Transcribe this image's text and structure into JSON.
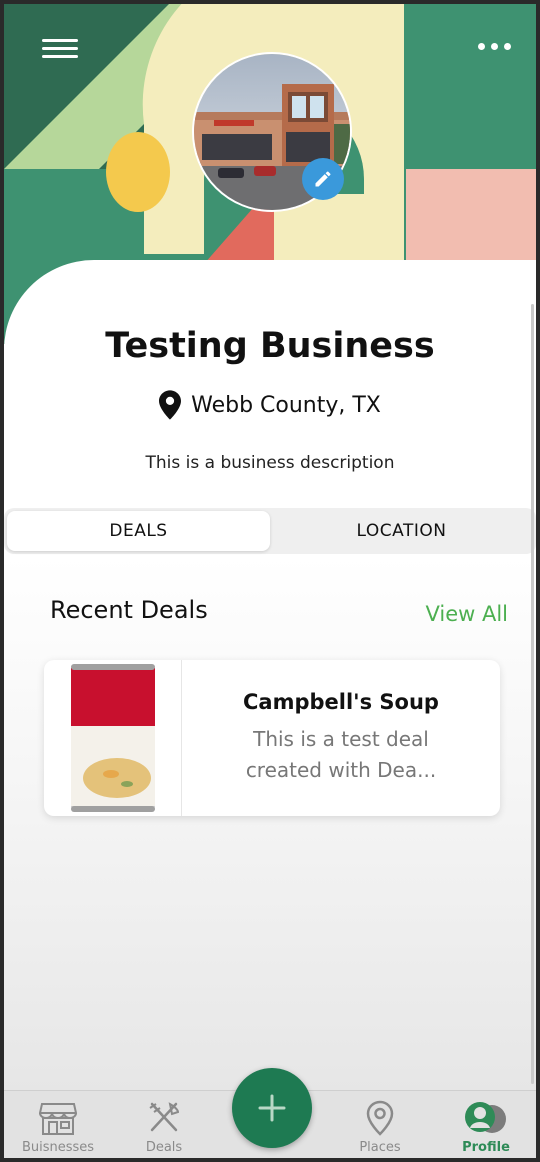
{
  "header": {
    "menu_icon": "hamburger-menu-icon",
    "more_icon": "more-dots-icon",
    "avatar_alt": "business photo",
    "edit_icon": "pencil-icon"
  },
  "profile": {
    "name": "Testing Business",
    "location": "Webb County, TX",
    "description": "This is a business description"
  },
  "tabs": [
    {
      "label": "DEALS",
      "active": true
    },
    {
      "label": "LOCATION",
      "active": false
    }
  ],
  "recent_deals": {
    "title": "Recent Deals",
    "view_all": "View All",
    "items": [
      {
        "title": "Campbell's Soup",
        "description_line1": "This is a test deal",
        "description_line2": "created with Dea..."
      }
    ]
  },
  "bottom_nav": {
    "items": [
      {
        "label": "Buisnesses",
        "icon": "store-icon"
      },
      {
        "label": "Deals",
        "icon": "fork-knife-icon"
      },
      {
        "label": "Places",
        "icon": "map-pin-icon"
      },
      {
        "label": "Profile",
        "icon": "profile-icon",
        "active": true
      }
    ],
    "fab_icon": "plus-icon"
  },
  "colors": {
    "accent_green": "#4caf50",
    "dark_green": "#1e7a52",
    "edit_blue": "#3a99db"
  }
}
